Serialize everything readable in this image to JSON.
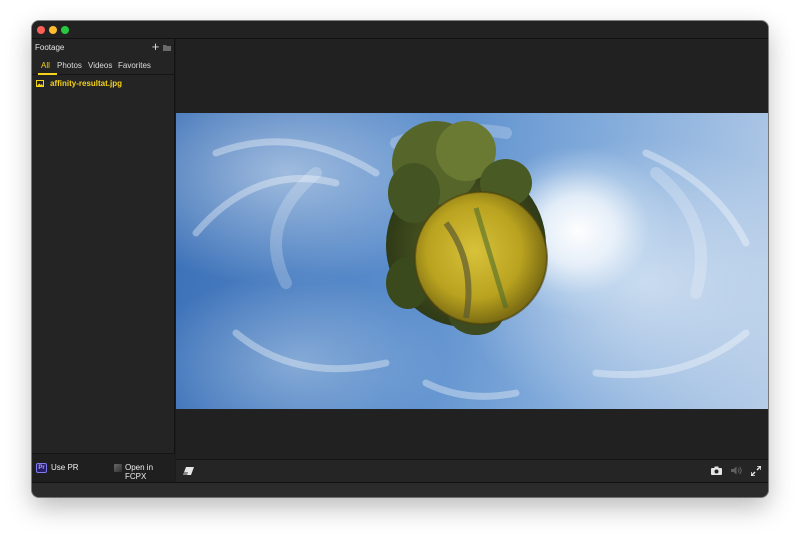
{
  "sidebar": {
    "title": "Footage",
    "tabs": [
      {
        "label": "All",
        "active": true
      },
      {
        "label": "Photos",
        "active": false
      },
      {
        "label": "Videos",
        "active": false
      },
      {
        "label": "Favorites",
        "active": false
      }
    ],
    "files": [
      {
        "name": "affinity-resultat.jpg",
        "icon": "image-icon"
      }
    ],
    "footer": {
      "pr_icon_text": "Pr",
      "pr_label": "Use PR",
      "fcpx_label": "Open in FCPX"
    }
  },
  "preview": {
    "image_alt": "tiny planet photo"
  },
  "colors": {
    "accent": "#f5d319",
    "window_bg": "#1c1c1c",
    "sidebar_bg": "#242424"
  },
  "icons": [
    "plus-icon",
    "folder-icon",
    "image-icon",
    "grid-icon",
    "list-icon",
    "trash-icon",
    "eraser-icon",
    "camera-icon",
    "volume-icon",
    "expand-icon"
  ]
}
